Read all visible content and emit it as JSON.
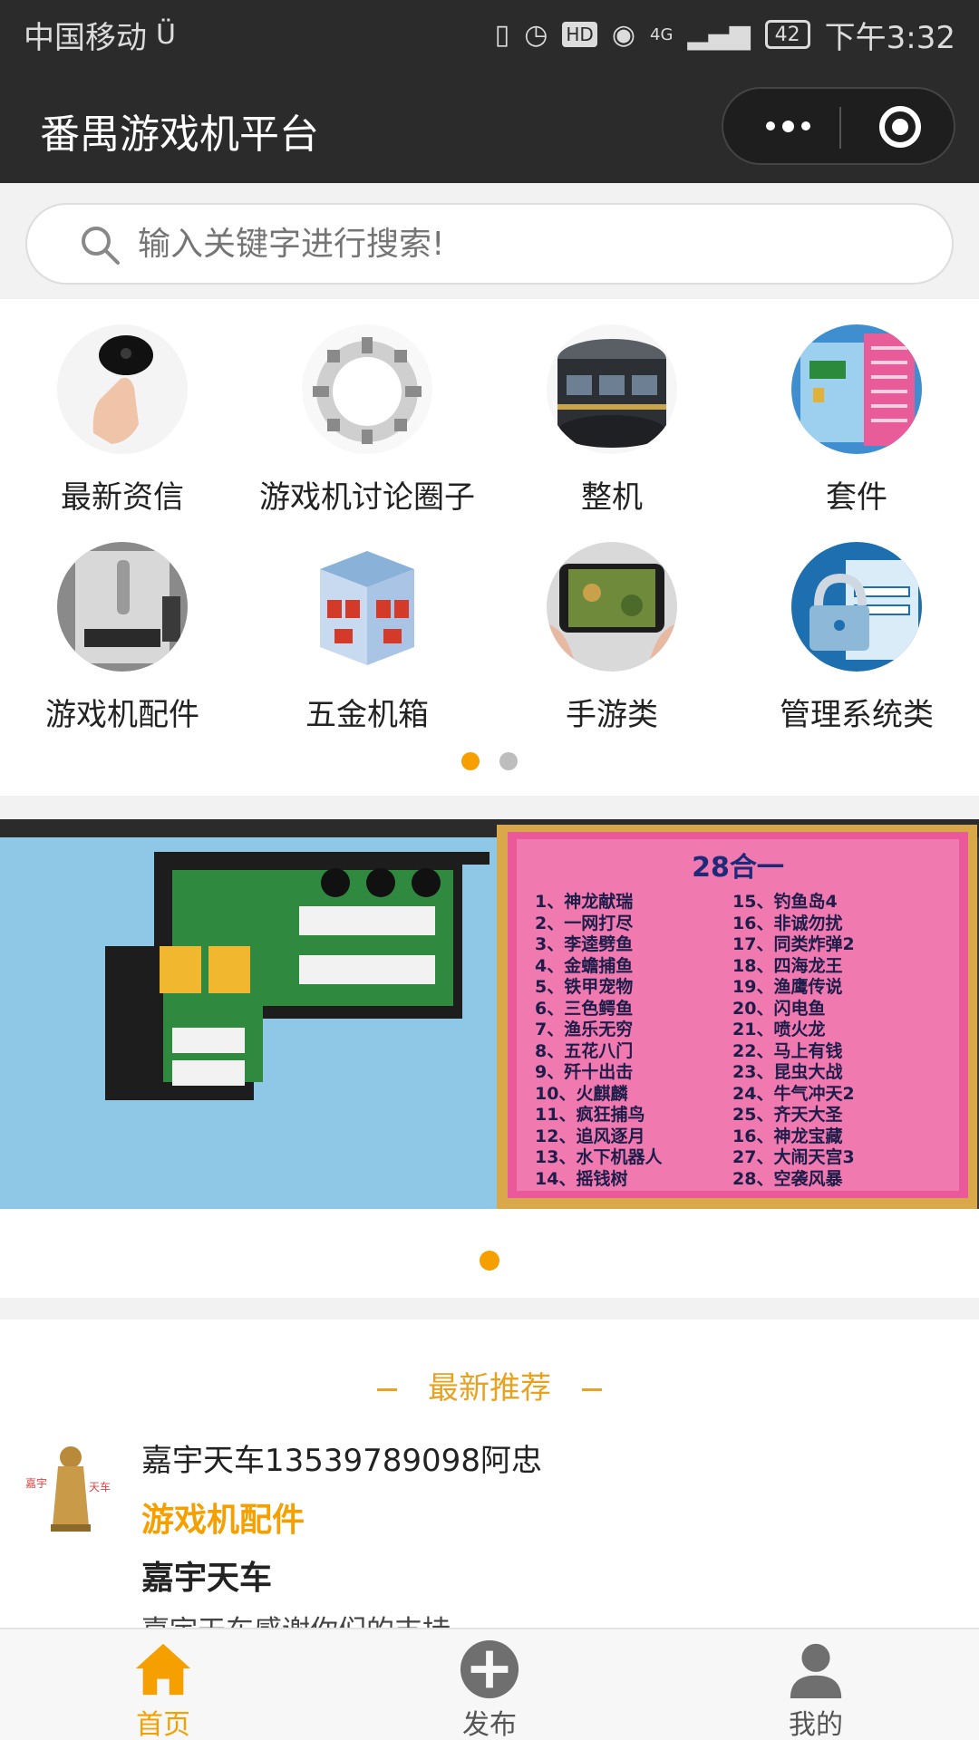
{
  "status_bar": {
    "carrier": "中国移动",
    "hd": "HD",
    "network": "4G",
    "battery": "42",
    "time": "下午3:32"
  },
  "header": {
    "title": "番禺游戏机平台"
  },
  "search": {
    "placeholder": "输入关键字进行搜索!"
  },
  "categories": [
    {
      "label": "最新资信",
      "icon": "finger-device-icon"
    },
    {
      "label": "游戏机讨论圈子",
      "icon": "ring-table-icon"
    },
    {
      "label": "整机",
      "icon": "arcade-cabinet-icon"
    },
    {
      "label": "套件",
      "icon": "board-kit-icon"
    },
    {
      "label": "游戏机配件",
      "icon": "coin-acceptor-icon"
    },
    {
      "label": "五金机箱",
      "icon": "metal-cabinet-icon"
    },
    {
      "label": "手游类",
      "icon": "mobile-game-icon"
    },
    {
      "label": "管理系统类",
      "icon": "lock-system-icon"
    }
  ],
  "category_pager": {
    "pages": 2,
    "active": 1
  },
  "banner": {
    "card_title": "28合一",
    "games_left": [
      "1、神龙献瑞",
      "2、一网打尽",
      "3、李逵劈鱼",
      "4、金蟾捕鱼",
      "5、铁甲宠物",
      "6、三色鳄鱼",
      "7、渔乐无穷",
      "8、五花八门",
      "9、歼十出击",
      "10、火麒麟",
      "11、疯狂捕鸟",
      "12、追风逐月",
      "13、水下机器人",
      "14、摇钱树"
    ],
    "games_right": [
      "15、钓鱼岛4",
      "16、非诚勿扰",
      "17、同类炸弹2",
      "18、四海龙王",
      "19、渔鹰传说",
      "20、闪电鱼",
      "21、喷火龙",
      "22、马上有钱",
      "23、昆虫大战",
      "24、牛气冲天2",
      "25、齐天大圣",
      "16、神龙宝藏",
      "27、大闹天宫3",
      "28、空袭风暴"
    ],
    "pager": {
      "pages": 1,
      "active": 1
    }
  },
  "recommend": {
    "title": "最新推荐",
    "item": {
      "name": "嘉宇天车13539789098阿忠",
      "category": "游戏机配件",
      "headline": "嘉宇天车",
      "description": "嘉宇天车感谢你们的支持",
      "avatar_text_left": "嘉宇",
      "avatar_text_right": "天车"
    }
  },
  "tabbar": [
    {
      "label": "首页",
      "icon": "home-icon",
      "active": true
    },
    {
      "label": "发布",
      "icon": "plus-circle-icon",
      "active": false
    },
    {
      "label": "我的",
      "icon": "user-icon",
      "active": false
    }
  ],
  "colors": {
    "accent": "#f5a000",
    "header_bg": "#2b2b2b",
    "recommend_title": "#e9a21f"
  }
}
